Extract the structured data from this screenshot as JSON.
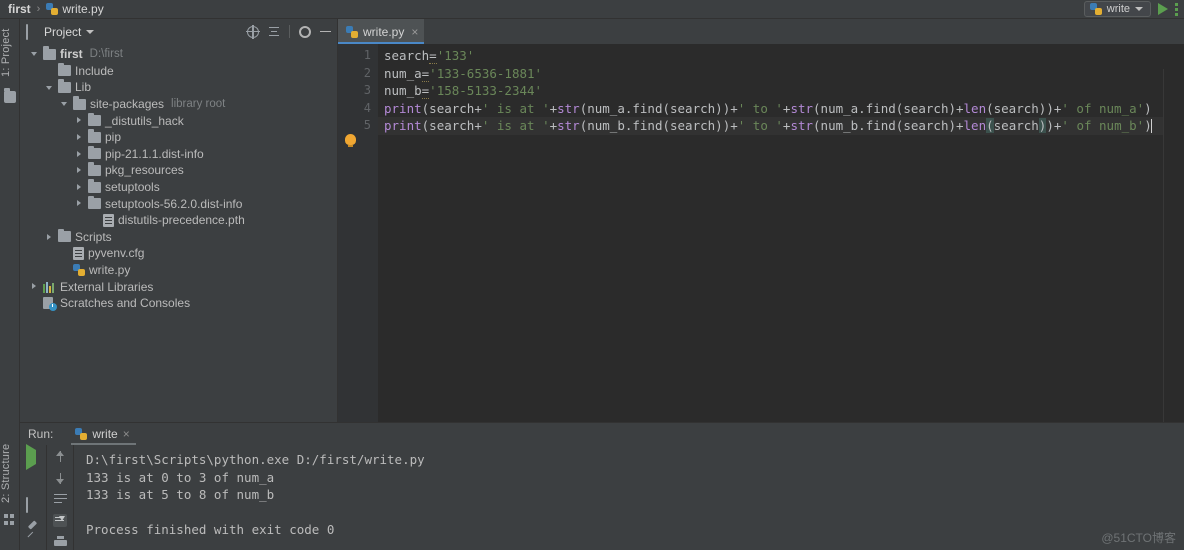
{
  "window": {
    "breadcrumb": {
      "project": "first",
      "separator": "›",
      "file": "write.py"
    },
    "run_config": {
      "label": "write"
    },
    "watermark": "@51CTO博客"
  },
  "tool_strips": {
    "left_top_label": "1: Project",
    "left_bottom_label": "2: Structure"
  },
  "project_panel": {
    "title": "Project",
    "actions": [
      "locate-icon",
      "collapse-all-icon",
      "settings-icon",
      "hide-icon"
    ],
    "tree": [
      {
        "indent": 0,
        "arrow": "down",
        "icon": "folder",
        "label": "first",
        "bold": true,
        "hint": "D:\\first"
      },
      {
        "indent": 1,
        "arrow": "none",
        "icon": "folder",
        "label": "Include",
        "bold": false,
        "hint": ""
      },
      {
        "indent": 1,
        "arrow": "down",
        "icon": "folder",
        "label": "Lib",
        "bold": false,
        "hint": ""
      },
      {
        "indent": 2,
        "arrow": "down",
        "icon": "folder",
        "label": "site-packages",
        "bold": false,
        "hint": "library root"
      },
      {
        "indent": 3,
        "arrow": "right",
        "icon": "folder",
        "label": "_distutils_hack",
        "bold": false,
        "hint": ""
      },
      {
        "indent": 3,
        "arrow": "right",
        "icon": "folder",
        "label": "pip",
        "bold": false,
        "hint": ""
      },
      {
        "indent": 3,
        "arrow": "right",
        "icon": "folder",
        "label": "pip-21.1.1.dist-info",
        "bold": false,
        "hint": ""
      },
      {
        "indent": 3,
        "arrow": "right",
        "icon": "folder",
        "label": "pkg_resources",
        "bold": false,
        "hint": ""
      },
      {
        "indent": 3,
        "arrow": "right",
        "icon": "folder",
        "label": "setuptools",
        "bold": false,
        "hint": ""
      },
      {
        "indent": 3,
        "arrow": "right",
        "icon": "folder",
        "label": "setuptools-56.2.0.dist-info",
        "bold": false,
        "hint": ""
      },
      {
        "indent": 4,
        "arrow": "none",
        "icon": "file",
        "label": "distutils-precedence.pth",
        "bold": false,
        "hint": ""
      },
      {
        "indent": 1,
        "arrow": "right",
        "icon": "folder",
        "label": "Scripts",
        "bold": false,
        "hint": ""
      },
      {
        "indent": 2,
        "arrow": "none",
        "icon": "file",
        "label": "pyvenv.cfg",
        "bold": false,
        "hint": ""
      },
      {
        "indent": 2,
        "arrow": "none",
        "icon": "python",
        "label": "write.py",
        "bold": false,
        "hint": ""
      },
      {
        "indent": 0,
        "arrow": "right",
        "icon": "library",
        "label": "External Libraries",
        "bold": false,
        "hint": ""
      },
      {
        "indent": 0,
        "arrow": "none",
        "icon": "scratch",
        "label": "Scratches and Consoles",
        "bold": false,
        "hint": ""
      }
    ]
  },
  "editor": {
    "tabs": [
      {
        "label": "write.py",
        "icon": "python-file-icon",
        "active": true,
        "close": "×"
      }
    ],
    "line_numbers": [
      "1",
      "2",
      "3",
      "4",
      "5"
    ],
    "lines": [
      [
        {
          "t": "search",
          "c": "var"
        },
        {
          "t": "=",
          "c": "warn"
        },
        {
          "t": "'133'",
          "c": "str"
        }
      ],
      [
        {
          "t": "num_a",
          "c": "var"
        },
        {
          "t": "=",
          "c": "warn"
        },
        {
          "t": "'133-6536-1881'",
          "c": "str"
        }
      ],
      [
        {
          "t": "num_b",
          "c": "var"
        },
        {
          "t": "=",
          "c": "warn"
        },
        {
          "t": "'158-5133-2344'",
          "c": "str"
        }
      ],
      [
        {
          "t": "print",
          "c": "fn"
        },
        {
          "t": "(search+",
          "c": "op"
        },
        {
          "t": "' is at '",
          "c": "str"
        },
        {
          "t": "+",
          "c": "op"
        },
        {
          "t": "str",
          "c": "fn"
        },
        {
          "t": "(num_a.find(search))+",
          "c": "op"
        },
        {
          "t": "' to '",
          "c": "str"
        },
        {
          "t": "+",
          "c": "op"
        },
        {
          "t": "str",
          "c": "fn"
        },
        {
          "t": "(num_a.find(search)+",
          "c": "op"
        },
        {
          "t": "len",
          "c": "fn"
        },
        {
          "t": "(search))+",
          "c": "op"
        },
        {
          "t": "' of num_a'",
          "c": "str"
        },
        {
          "t": ")",
          "c": "op"
        }
      ],
      [
        {
          "t": "print",
          "c": "fn"
        },
        {
          "t": "(search+",
          "c": "op"
        },
        {
          "t": "' is at '",
          "c": "str"
        },
        {
          "t": "+",
          "c": "op"
        },
        {
          "t": "str",
          "c": "fn"
        },
        {
          "t": "(num_b.find(search))+",
          "c": "op"
        },
        {
          "t": "' to '",
          "c": "str"
        },
        {
          "t": "+",
          "c": "op"
        },
        {
          "t": "str",
          "c": "fn"
        },
        {
          "t": "(num_b.find(search)+",
          "c": "op"
        },
        {
          "t": "len",
          "c": "fn"
        },
        {
          "t": "(",
          "c": "match"
        },
        {
          "t": "search",
          "c": "op"
        },
        {
          "t": ")",
          "c": "match"
        },
        {
          "t": ")+",
          "c": "op"
        },
        {
          "t": "' of num_b'",
          "c": "str"
        },
        {
          "t": ")",
          "c": "op"
        }
      ]
    ],
    "current_line": 5,
    "gutter_icon_line": 4,
    "gutter_icon": "intention-bulb-icon"
  },
  "run_panel": {
    "label": "Run:",
    "tab": {
      "name": "write",
      "close": "×",
      "icon": "python-icon"
    },
    "tools_left": [
      "rerun-icon",
      "stop-icon",
      "expose-icon",
      "pin-icon"
    ],
    "tools_right": [
      "up-arrow-icon",
      "down-arrow-icon",
      "soft-wrap-icon",
      "scroll-to-end-icon",
      "print-icon"
    ],
    "console": [
      "D:\\first\\Scripts\\python.exe D:/first/write.py",
      "133 is at 0 to 3 of num_a",
      "133 is at 5 to 8 of num_b",
      "",
      "Process finished with exit code 0"
    ]
  },
  "colors": {
    "accent": "#4a88c7",
    "string": "#6a8759",
    "function": "#b389d6",
    "editor_bg": "#2b2b2b",
    "panel_bg": "#3c3f41",
    "run_green": "#5b9e4f"
  }
}
